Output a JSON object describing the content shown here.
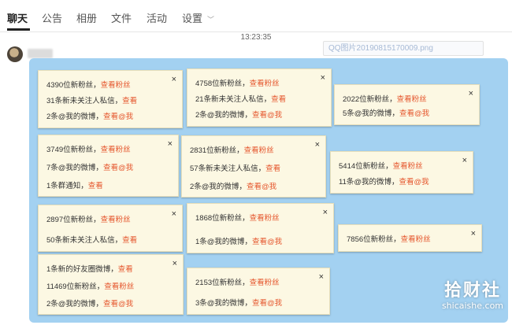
{
  "tabs": [
    {
      "label": "聊天"
    },
    {
      "label": "公告"
    },
    {
      "label": "相册"
    },
    {
      "label": "文件"
    },
    {
      "label": "活动"
    },
    {
      "label": "设置"
    }
  ],
  "settings_chevron": "﹀",
  "timestamp": "13:23:35",
  "file_chip": "QQ图片20190815170009.png",
  "close_glyph": "×",
  "cards": [
    {
      "lines": [
        {
          "t": "4390位新粉丝，",
          "h": "查看粉丝"
        },
        {
          "t": "31条新未关注人私信，",
          "h": "查看"
        },
        {
          "t": "2条@我的微博，",
          "h": "查看@我"
        }
      ]
    },
    {
      "lines": [
        {
          "t": "4758位新粉丝，",
          "h": "查看粉丝"
        },
        {
          "t": "21条新未关注人私信，",
          "h": "查看"
        },
        {
          "t": "2条@我的微博，",
          "h": "查看@我"
        }
      ]
    },
    {
      "lines": [
        {
          "t": "2022位新粉丝，",
          "h": "查看粉丝"
        },
        {
          "t": "5条@我的微博，",
          "h": "查看@我"
        }
      ]
    },
    {
      "lines": [
        {
          "t": "3749位新粉丝，",
          "h": "查看粉丝"
        },
        {
          "t": "7条@我的微博，",
          "h": "查看@我"
        },
        {
          "t": "1条群通知，",
          "h": "查看"
        }
      ]
    },
    {
      "lines": [
        {
          "t": "2831位新粉丝，",
          "h": "查看粉丝"
        },
        {
          "t": "57条新未关注人私信，",
          "h": "查看"
        },
        {
          "t": "2条@我的微博，",
          "h": "查看@我"
        }
      ]
    },
    {
      "lines": [
        {
          "t": "5414位新粉丝，",
          "h": "查看粉丝"
        },
        {
          "t": "11条@我的微博，",
          "h": "查看@我"
        }
      ]
    },
    {
      "lines": [
        {
          "t": "2897位新粉丝，",
          "h": "查看粉丝"
        },
        {
          "t": "50条新未关注人私信，",
          "h": "查看"
        }
      ]
    },
    {
      "lines": [
        {
          "t": "1868位新粉丝，",
          "h": "查看粉丝"
        },
        {
          "t": "1条@我的微博，",
          "h": "查看@我"
        }
      ]
    },
    {
      "lines": [
        {
          "t": "7856位新粉丝，",
          "h": "查看粉丝"
        }
      ]
    },
    {
      "lines": [
        {
          "t": "1条新的好友圈微博，",
          "h": "查看"
        },
        {
          "t": "11469位新粉丝，",
          "h": "查看粉丝"
        },
        {
          "t": "2条@我的微博，",
          "h": "查看@我"
        }
      ]
    },
    {
      "lines": [
        {
          "t": "2153位新粉丝，",
          "h": "查看粉丝"
        },
        {
          "t": "3条@我的微博，",
          "h": "查看@我"
        }
      ]
    }
  ],
  "watermark": {
    "big": "拾财社",
    "small": "shicaishe.com"
  },
  "colors": {
    "accent": "#e5562d",
    "bubble": "#a3d1f1",
    "card": "#fcf8e3"
  }
}
